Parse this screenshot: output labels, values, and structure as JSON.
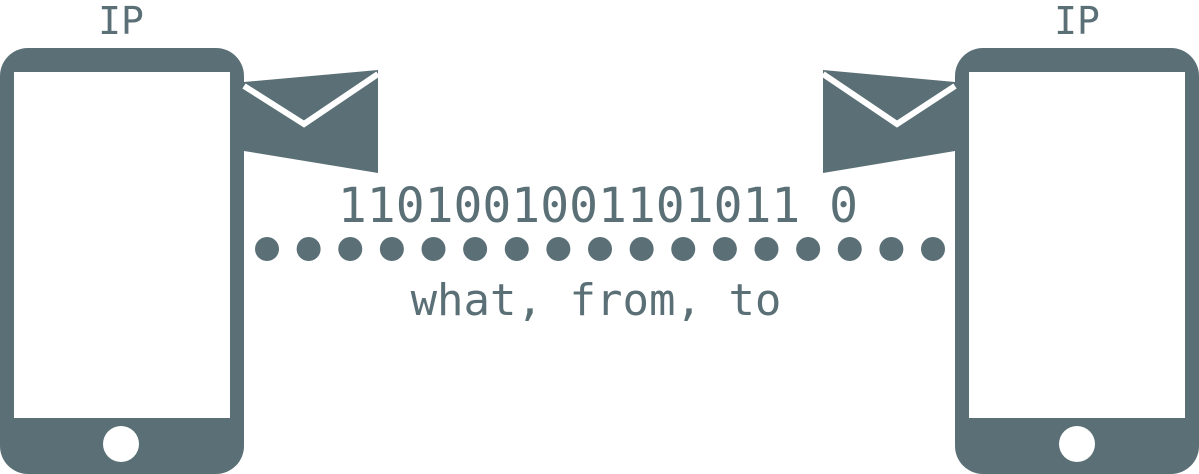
{
  "diagram": {
    "colors": {
      "device": "#5b7076",
      "screen": "#ffffff",
      "text": "#5b7076"
    },
    "left_device": {
      "label": "IP",
      "icon": "smartphone-icon",
      "message_icon": "envelope-icon"
    },
    "right_device": {
      "label": "IP",
      "icon": "smartphone-icon",
      "message_icon": "envelope-icon"
    },
    "bits": "1101001001101011 0",
    "link_label": "what, from, to",
    "dot_count": 17
  }
}
